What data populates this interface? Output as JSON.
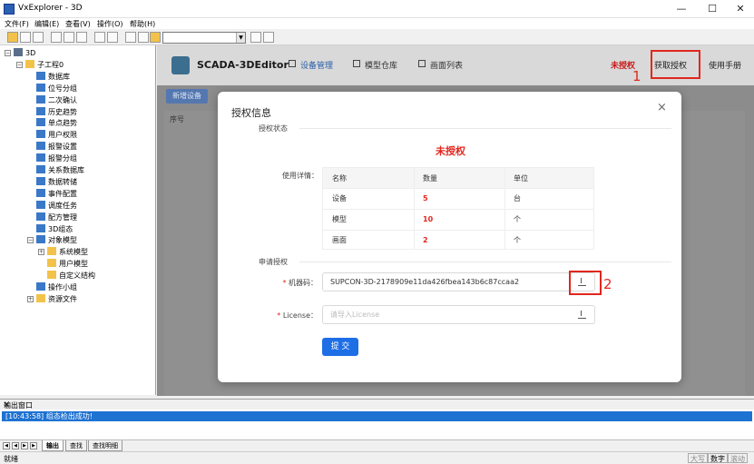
{
  "window": {
    "title": "VxExplorer - 3D",
    "min": "—",
    "max": "☐",
    "close": "✕"
  },
  "menu": [
    "文件(F)",
    "编辑(E)",
    "查看(V)",
    "操作(O)",
    "帮助(H)"
  ],
  "tree": {
    "root": "3D",
    "project": "子工程0",
    "items": [
      "数据库",
      "位号分组",
      "二次确认",
      "历史趋势",
      "单点趋势",
      "用户权限",
      "报警设置",
      "报警分组",
      "关系数据库",
      "数据转储",
      "事件配置",
      "调度任务",
      "配方管理",
      "3D组态"
    ],
    "object_model": "对象模型",
    "model_children": [
      "系统模型",
      "用户模型",
      "自定义结构"
    ],
    "tail": [
      "操作小组",
      "资源文件"
    ]
  },
  "app": {
    "brand": "SCADA-3DEditor",
    "nav": [
      "设备管理",
      "模型仓库",
      "画面列表"
    ],
    "unauth": "未授权",
    "get_auth": "获取授权",
    "manual": "使用手册",
    "marker1": "1",
    "add_device": "新增设备",
    "seq_header": "序号"
  },
  "modal": {
    "title": "授权信息",
    "close": "×",
    "section_status": "授权状态",
    "status_value": "未授权",
    "detail_label": "使用详情：",
    "table": {
      "headers": [
        "名称",
        "数量",
        "单位"
      ],
      "rows": [
        [
          "设备",
          "5",
          "台"
        ],
        [
          "模型",
          "10",
          "个"
        ],
        [
          "画面",
          "2",
          "个"
        ]
      ]
    },
    "section_apply": "申请授权",
    "machine_label": "机器码：",
    "machine_value": "SUPCON-3D-2178909e11da426fbea143b6c87ccaa2",
    "license_label": "License：",
    "license_placeholder": "请导入License",
    "required": "*",
    "submit": "提 交",
    "marker2": "2"
  },
  "output": {
    "title": "输出窗口",
    "close": "×",
    "line": "[10:43:58] 组态检出成功!",
    "tabs": [
      "输出",
      "查找",
      "查找明细"
    ]
  },
  "status": {
    "ready": "就绪",
    "indicators": [
      "大写",
      "数字",
      "滚动"
    ]
  },
  "colors": {
    "accent": "#1e6ee6",
    "alert": "#e0271e"
  }
}
